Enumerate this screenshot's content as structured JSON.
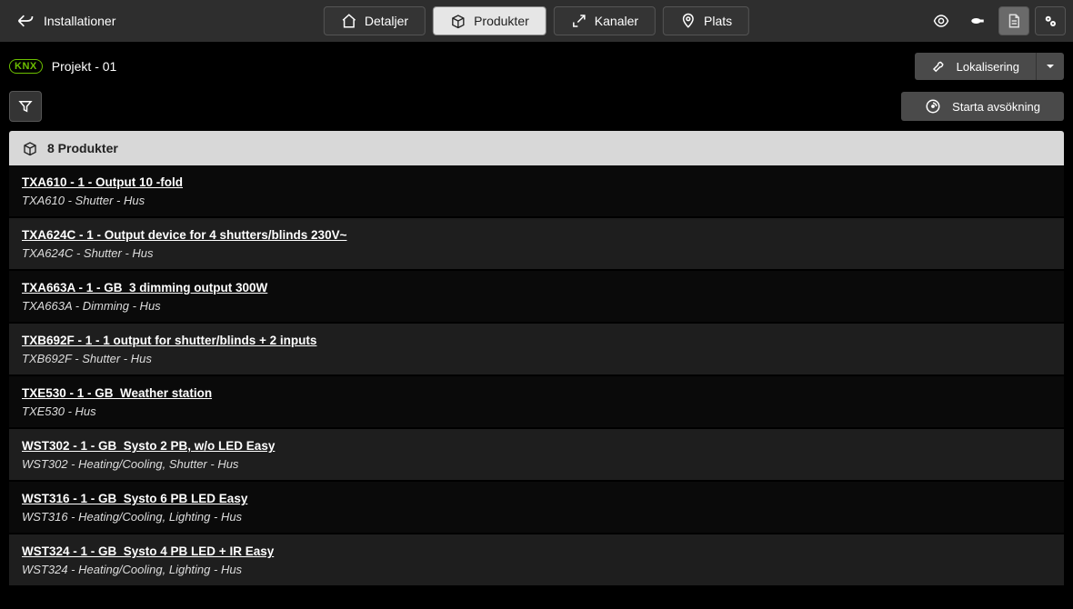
{
  "topbar": {
    "back_label": "Installationer",
    "tabs": {
      "details": "Detaljer",
      "products": "Produkter",
      "channels": "Kanaler",
      "place": "Plats"
    }
  },
  "project": {
    "logo": "KNX",
    "name": "Projekt - 01"
  },
  "actions": {
    "localization": "Lokalisering",
    "scan": "Starta avsökning"
  },
  "list": {
    "header": "8 Produkter",
    "items": [
      {
        "title": "TXA610 - 1 - Output 10 -fold",
        "sub": "TXA610 - Shutter - Hus"
      },
      {
        "title": "TXA624C - 1 - Output device for 4 shutters/blinds 230V~",
        "sub": "TXA624C - Shutter - Hus"
      },
      {
        "title": "TXA663A - 1 - GB_3 dimming output 300W",
        "sub": "TXA663A - Dimming - Hus"
      },
      {
        "title": "TXB692F - 1 - 1 output for shutter/blinds + 2 inputs",
        "sub": "TXB692F - Shutter - Hus"
      },
      {
        "title": "TXE530 - 1 - GB_Weather station",
        "sub": "TXE530 - Hus"
      },
      {
        "title": "WST302 - 1 - GB_Systo 2 PB, w/o LED Easy",
        "sub": "WST302 - Heating/Cooling, Shutter - Hus"
      },
      {
        "title": "WST316 - 1 - GB_Systo 6 PB LED Easy",
        "sub": "WST316 - Heating/Cooling, Lighting - Hus"
      },
      {
        "title": "WST324 - 1 - GB_Systo 4 PB LED + IR Easy",
        "sub": "WST324 - Heating/Cooling, Lighting - Hus"
      }
    ]
  }
}
